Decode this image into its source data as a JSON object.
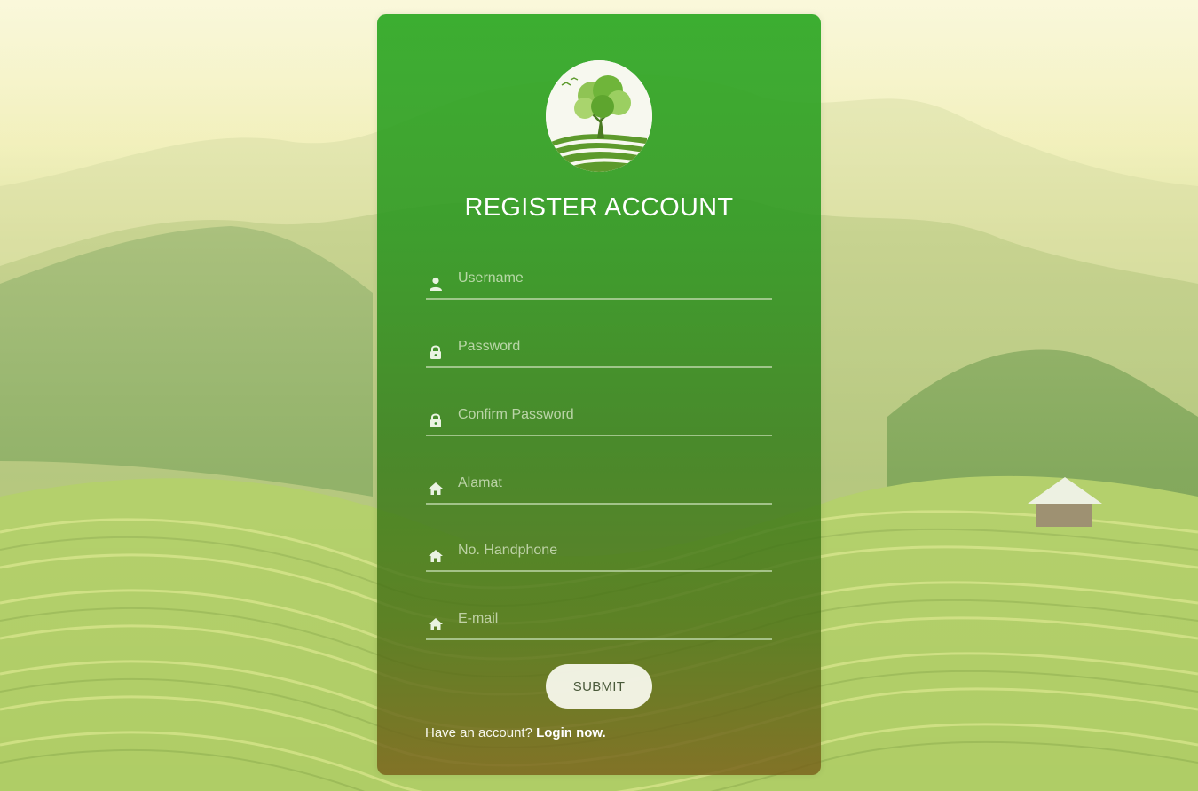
{
  "register": {
    "title": "REGISTER ACCOUNT",
    "fields": [
      {
        "name": "username",
        "placeholder": "Username",
        "icon": "user-icon"
      },
      {
        "name": "password",
        "placeholder": "Password",
        "icon": "lock-icon"
      },
      {
        "name": "confirm_password",
        "placeholder": "Confirm Password",
        "icon": "lock-icon"
      },
      {
        "name": "alamat",
        "placeholder": "Alamat",
        "icon": "home-icon"
      },
      {
        "name": "handphone",
        "placeholder": "No. Handphone",
        "icon": "home-icon"
      },
      {
        "name": "email",
        "placeholder": "E-mail",
        "icon": "home-icon"
      }
    ],
    "submit_label": "SUBMIT",
    "footer_prompt": "Have an account?",
    "login_link": "Login now."
  },
  "colors": {
    "card_green": "#32aa28",
    "card_bottom": "#785f19",
    "field_line": "#bed7aa",
    "button_bg": "#fafaf0"
  }
}
